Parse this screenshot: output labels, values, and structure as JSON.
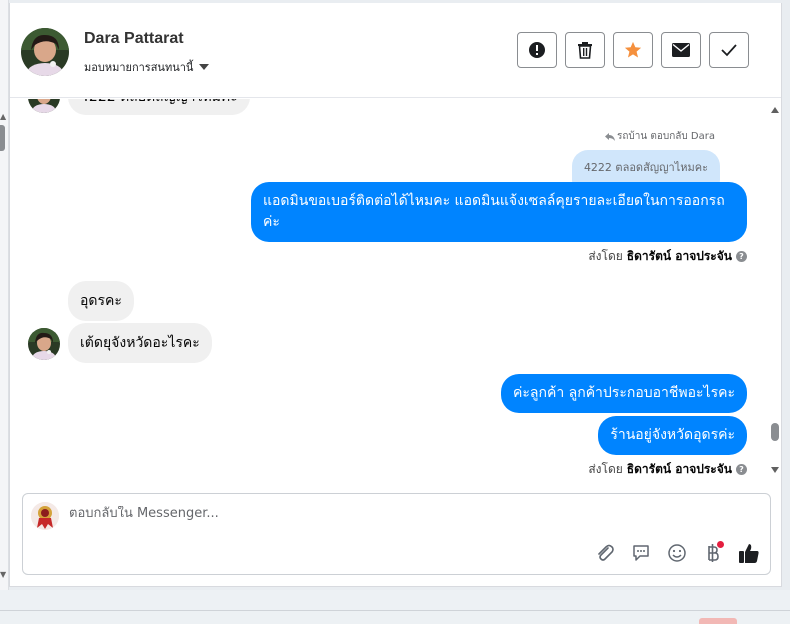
{
  "contact": {
    "name": "Dara Pattarat",
    "assign_label": "มอบหมายการสนทนานี้"
  },
  "header_actions": [
    {
      "name": "report-button",
      "icon": "alert-circle-icon"
    },
    {
      "name": "delete-button",
      "icon": "trash-icon"
    },
    {
      "name": "star-button",
      "icon": "star-icon"
    },
    {
      "name": "mark-unread-button",
      "icon": "envelope-icon"
    },
    {
      "name": "mark-done-button",
      "icon": "check-icon"
    }
  ],
  "messages": {
    "cut_off_text": "4222 ตลอดสัญญาไหมคะ",
    "reply_meta": "รถบ้าน ตอบกลับ Dara",
    "reply_quote": "4222 ตลอดสัญญาไหมคะ",
    "out_1": "แอดมินขอเบอร์ติดต่อได้ไหมคะ แอดมินแจ้งเซลล์คุยรายละเอียดในการออกรถค่ะ",
    "sent_by_prefix_1": "ส่งโดย",
    "sent_by_name_1": "ธิดารัตน์ อาจประจัน",
    "in_1": "อุดรคะ",
    "in_2": "เต้ดยุจังหวัดอะไรคะ",
    "out_2": "ค่ะลูกค้า ลูกค้าประกอบอาชีพอะไรคะ",
    "out_3": "ร้านอยู่จังหวัดอุดรค่ะ",
    "sent_by_prefix_2": "ส่งโดย",
    "sent_by_name_2": "ธิดารัตน์ อาจประจัน"
  },
  "composer": {
    "placeholder": "ตอบกลับใน Messenger..."
  },
  "composer_tools": [
    "paperclip-icon",
    "chat-bubble-icon",
    "smiley-icon",
    "baht-icon",
    "thumbs-up-icon"
  ],
  "colors": {
    "outgoing_bubble": "#0084ff",
    "incoming_bubble": "#f0f0f0",
    "reply_quote": "#d0e6fb",
    "star": "#f5903d",
    "notification_dot": "#e41e3f"
  }
}
